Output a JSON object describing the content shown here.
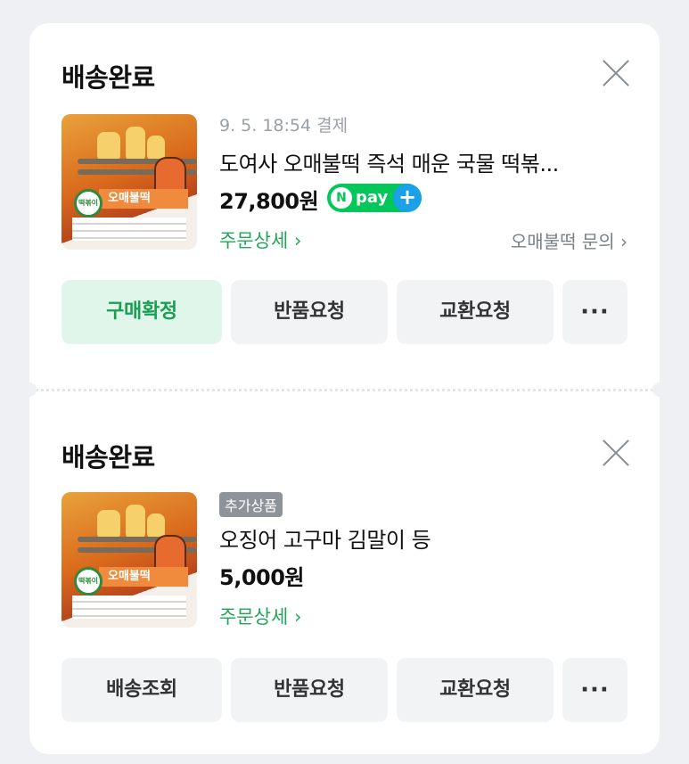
{
  "orders": [
    {
      "status": "배송완료",
      "date": "9. 5. 18:54 결제",
      "title": "도여사 오매불떡 즉석 매운 국물 떡볶...",
      "price": "27,800원",
      "npay_label": "pay",
      "detail_label": "주문상세 ›",
      "inquiry_label": "오매불떡 문의 ›",
      "thumb_label": "오매불떡",
      "thumb_badge": "떡볶이",
      "buttons": [
        "구매확정",
        "반품요청",
        "교환요청",
        "···"
      ]
    },
    {
      "status": "배송완료",
      "addon_badge": "추가상품",
      "title": "오징어 고구마 김말이 등",
      "price": "5,000원",
      "detail_label": "주문상세 ›",
      "thumb_label": "오매불떡",
      "thumb_badge": "떡볶이",
      "buttons": [
        "배송조회",
        "반품요청",
        "교환요청",
        "···"
      ]
    }
  ],
  "colors": {
    "accent": "#22a55a",
    "npay": "#03c75a",
    "primary_bg": "#e1f6ea"
  },
  "icons": {
    "close": "close-icon",
    "more": "more-icon"
  }
}
